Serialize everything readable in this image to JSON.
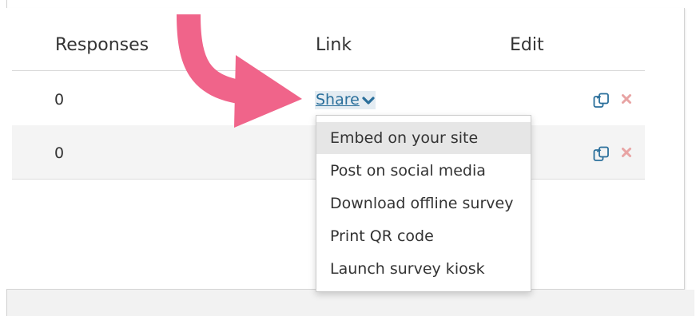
{
  "table": {
    "headers": {
      "responses": "Responses",
      "link": "Link",
      "edit": "Edit"
    },
    "rows": [
      {
        "responses": "0",
        "link": "Share"
      },
      {
        "responses": "0"
      }
    ]
  },
  "dropdown": {
    "items": [
      "Embed on your site",
      "Post on social media",
      "Download offline survey",
      "Print QR code",
      "Launch survey kiosk"
    ],
    "highlighted_index": 0
  },
  "icons": {
    "share_chevron": "chevron-down-icon",
    "copy": "copy-icon",
    "delete": "delete-icon"
  },
  "colors": {
    "link": "#2a6f9b",
    "arrow": "#f0648a",
    "delete": "#e8a4a4",
    "highlight": "#e6e6e6",
    "alt_row": "#f4f4f4"
  }
}
